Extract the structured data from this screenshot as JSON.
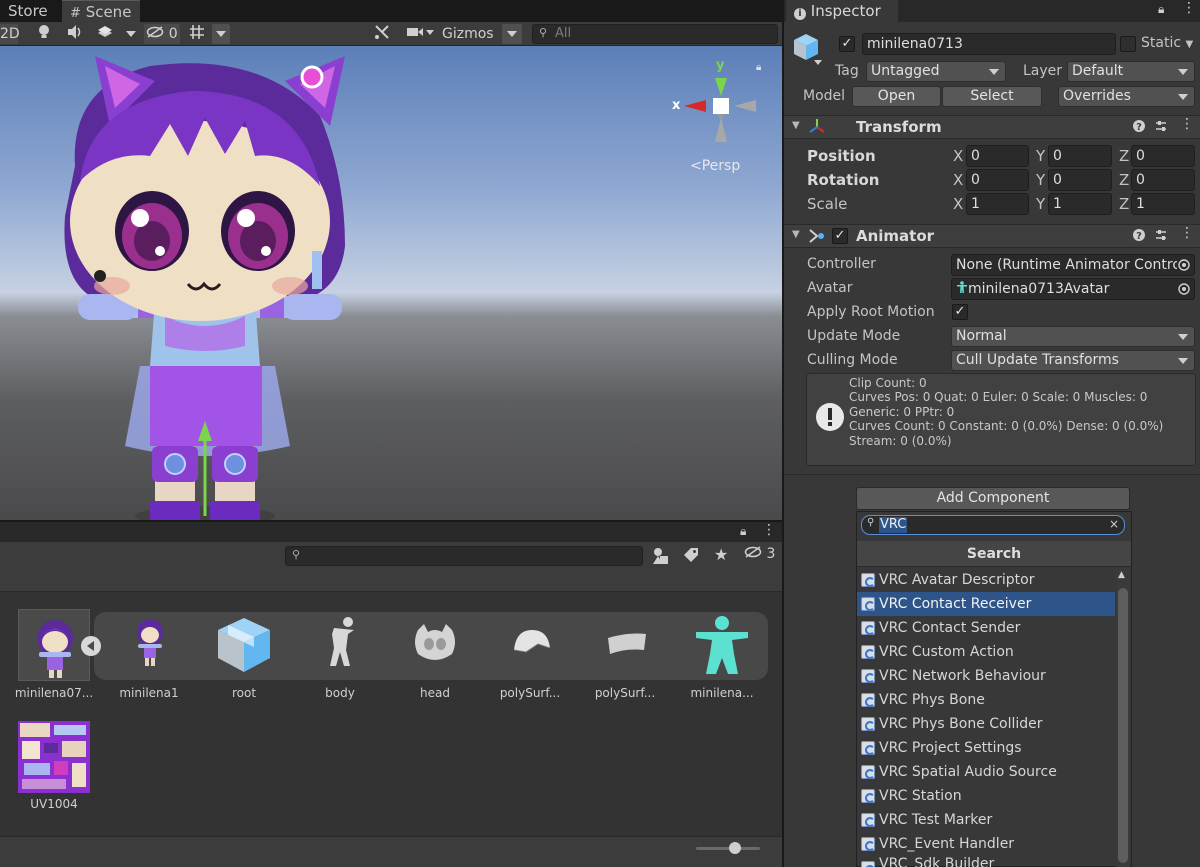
{
  "scene_tabs": {
    "store": "Store",
    "scene": "Scene",
    "scene_icon": "grid-icon"
  },
  "scene_toolbar": {
    "mode_2d": "2D",
    "hidden_count": "0",
    "gizmos": "Gizmos",
    "search_placeholder": "All"
  },
  "scene_view": {
    "persp": "Persp",
    "axis_x": "x",
    "axis_y": "y"
  },
  "project": {
    "hidden_count": "3",
    "assets": [
      {
        "label": "minilena07..."
      },
      {
        "label": "minilena1"
      },
      {
        "label": "root"
      },
      {
        "label": "body"
      },
      {
        "label": "head"
      },
      {
        "label": "polySurf..."
      },
      {
        "label": "polySurf..."
      },
      {
        "label": "minilena..."
      },
      {
        "label": "UV1004"
      }
    ]
  },
  "inspector": {
    "tab": "Inspector",
    "object_name": "minilena0713",
    "static_label": "Static",
    "tag_label": "Tag",
    "tag_value": "Untagged",
    "layer_label": "Layer",
    "layer_value": "Default",
    "model_label": "Model",
    "open": "Open",
    "select": "Select",
    "overrides": "Overrides",
    "transform": {
      "title": "Transform",
      "rows": [
        {
          "label": "Position",
          "x": "0",
          "y": "0",
          "z": "0"
        },
        {
          "label": "Rotation",
          "x": "0",
          "y": "0",
          "z": "0"
        },
        {
          "label": "Scale",
          "x": "1",
          "y": "1",
          "z": "1"
        }
      ],
      "x": "X",
      "y": "Y",
      "z": "Z"
    },
    "animator": {
      "title": "Animator",
      "controller_label": "Controller",
      "controller_value": "None (Runtime Animator Control",
      "avatar_label": "Avatar",
      "avatar_value": "minilena0713Avatar",
      "root_motion_label": "Apply Root Motion",
      "root_motion_check": "✓",
      "update_mode_label": "Update Mode",
      "update_mode_value": "Normal",
      "culling_mode_label": "Culling Mode",
      "culling_mode_value": "Cull Update Transforms",
      "info": [
        "Clip Count: 0",
        "Curves Pos: 0 Quat: 0 Euler: 0 Scale: 0 Muscles: 0",
        "Generic: 0 PPtr: 0",
        "Curves Count: 0 Constant: 0 (0.0%) Dense: 0 (0.0%)",
        "Stream: 0 (0.0%)"
      ]
    },
    "add_component": {
      "button": "Add Component",
      "search_value": "VRC",
      "search_title": "Search",
      "items": [
        "VRC Avatar Descriptor",
        "VRC Contact Receiver",
        "VRC Contact Sender",
        "VRC Custom Action",
        "VRC Network Behaviour",
        "VRC Phys Bone",
        "VRC Phys Bone Collider",
        "VRC Project Settings",
        "VRC Spatial Audio Source",
        "VRC Station",
        "VRC Test Marker",
        "VRC_Event Handler",
        "VRC_Sdk Builder"
      ],
      "selected_index": 1
    }
  },
  "colors": {
    "accent": "#2d5589",
    "character_purple": "#8a3fd0"
  }
}
